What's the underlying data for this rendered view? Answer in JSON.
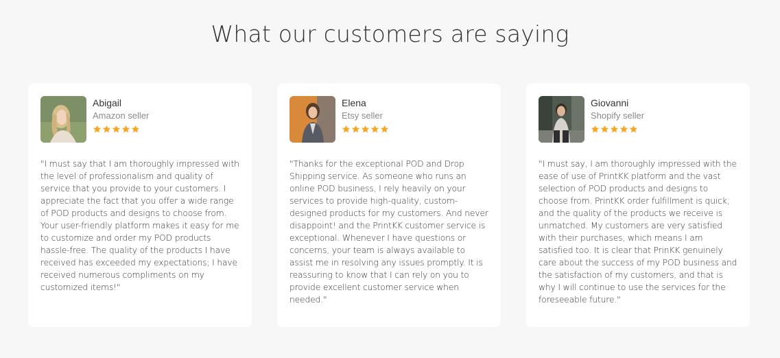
{
  "section": {
    "title": "What our customers are saying"
  },
  "colors": {
    "page_background": "#f7f7f7",
    "card_background": "#ffffff",
    "star": "#f5a623"
  },
  "testimonials": [
    {
      "name": "Abigail",
      "role": "Amazon seller",
      "rating": 5,
      "avatar_icon": "woman-blonde-avatar",
      "quote": "\"I must say that I am thoroughly impressed with the level of professionalism and quality of service that you provide to your customers. I appreciate the fact that you offer a wide range of POD products and designs to choose from. Your user-friendly platform makes it easy for me to customize and order my POD products hassle-free. The quality of the products I have received has exceeded my expectations; I have received numerous compliments on my customized items!\""
    },
    {
      "name": "Elena",
      "role": "Etsy seller",
      "rating": 5,
      "avatar_icon": "woman-orange-backdrop-avatar",
      "quote": "\"Thanks for the exceptional POD and Drop Shipping service. As someone who runs an online POD business, I rely heavily on your services to provide high-quality, custom-designed products for my customers. And never disappoint! and the PrintKK customer service is exceptional. Whenever I have questions or concerns, your team is always available to assist me in resolving any issues promptly. It is reassuring to know that I can rely on you to provide excellent customer service when needed.\""
    },
    {
      "name": "Giovanni",
      "role": "Shopify seller",
      "rating": 5,
      "avatar_icon": "man-outdoors-avatar",
      "quote": "\"I must say, I am thoroughly impressed with the ease of use of PrintKK platform and the vast selection of POD products and designs to choose from. PrintKK order fulfillment is quick, and the quality of the products we receive is unmatched. My customers are very satisfied with their purchases, which means I am satisfied too. It is clear that PrinKK genuinely care about the success of my POD business and the satisfaction of my customers, and that is why I will continue to use the services for the foreseeable future.\""
    }
  ]
}
